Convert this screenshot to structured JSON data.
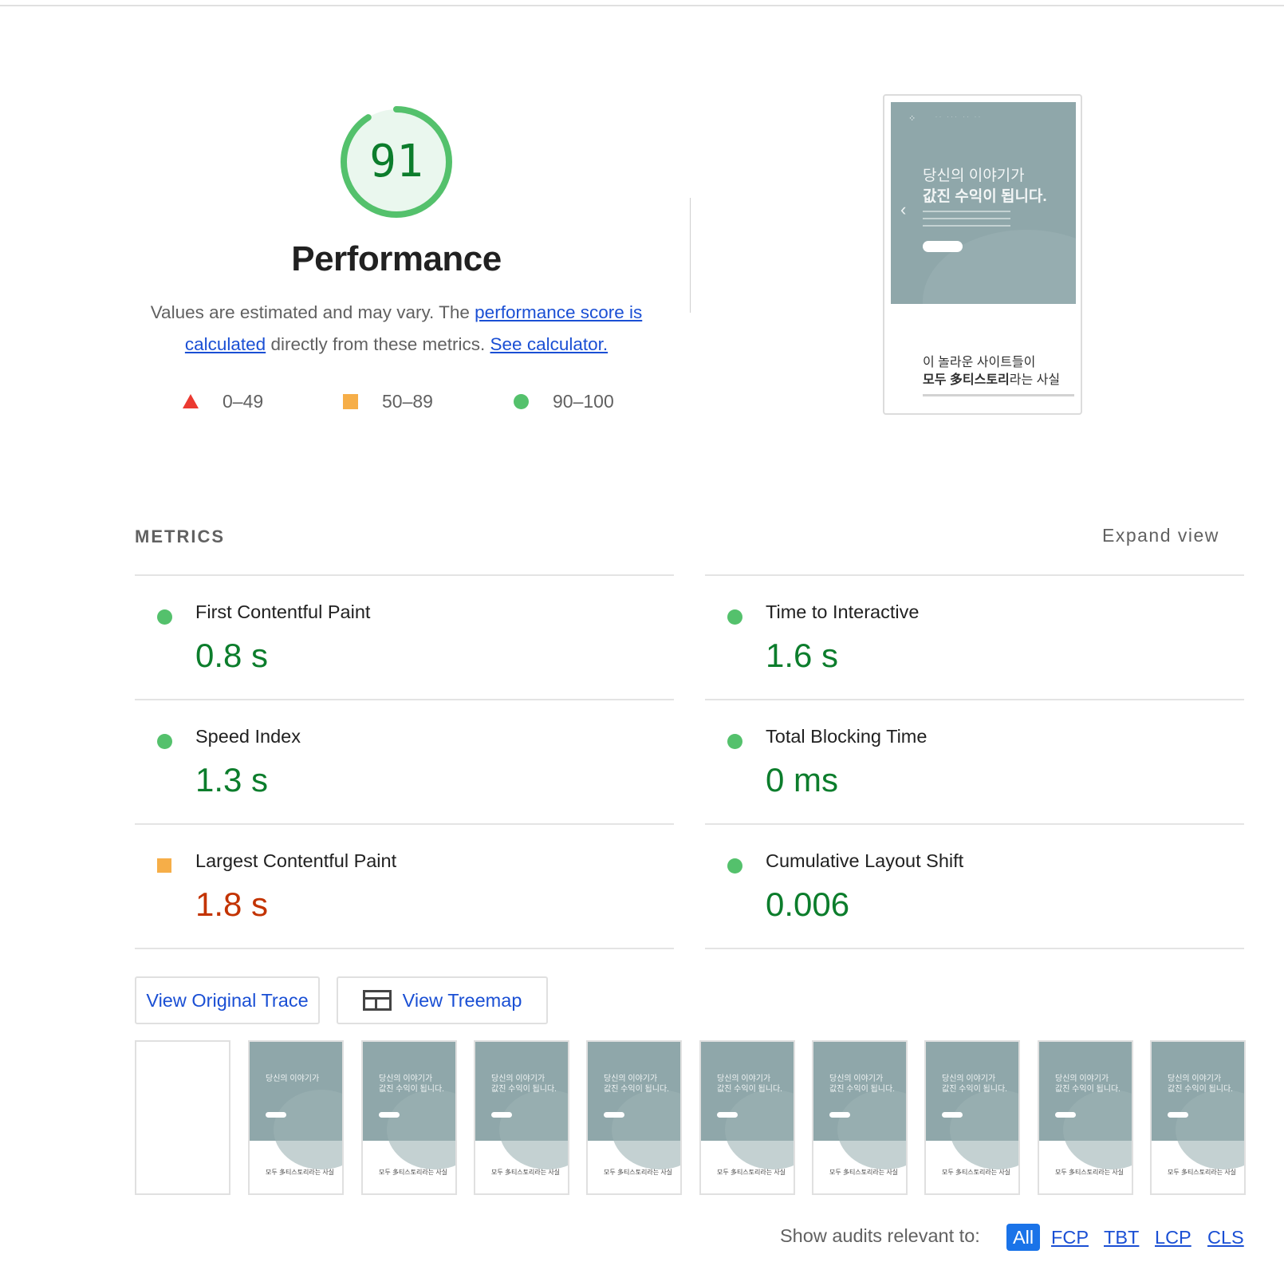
{
  "category": {
    "score": "91",
    "score_fraction": 0.91,
    "title": "Performance",
    "desc_text1": "Values are estimated and may vary. The ",
    "desc_link1": "performance score is calculated",
    "desc_text2": " directly from these metrics. ",
    "desc_link2": "See calculator."
  },
  "legend": [
    {
      "label": "0–49",
      "shape": "triangle",
      "color": "#eb3a31"
    },
    {
      "label": "50–89",
      "shape": "square",
      "color": "#f6ae48"
    },
    {
      "label": "90–100",
      "shape": "circle",
      "color": "#54c16c"
    }
  ],
  "preview": {
    "headline_line1": "당신의 이야기가",
    "headline_line2": "값진 수익이 됩니다.",
    "section_line1": "이 놀라운 사이트들이",
    "section_line2_bold": "모두 多티스토리",
    "section_line2_rest": "라는 사실"
  },
  "metrics": {
    "title": "METRICS",
    "expand_label": "Expand view",
    "items": [
      {
        "name": "First Contentful Paint",
        "value": "0.8 s",
        "rating": "good"
      },
      {
        "name": "Time to Interactive",
        "value": "1.6 s",
        "rating": "good"
      },
      {
        "name": "Speed Index",
        "value": "1.3 s",
        "rating": "good"
      },
      {
        "name": "Total Blocking Time",
        "value": "0 ms",
        "rating": "good"
      },
      {
        "name": "Largest Contentful Paint",
        "value": "1.8 s",
        "rating": "average"
      },
      {
        "name": "Cumulative Layout Shift",
        "value": "0.006",
        "rating": "good"
      }
    ]
  },
  "buttons": {
    "trace": "View Original Trace",
    "treemap": "View Treemap"
  },
  "filmstrip": {
    "frame_line1": "당신의 이야기가",
    "frame_line2": "값진 수익이 됩니다.",
    "frame_bottom": "모두 多티스토리라는 사실"
  },
  "audits": {
    "label": "Show audits relevant to:",
    "filters": [
      "All",
      "FCP",
      "TBT",
      "LCP",
      "CLS"
    ]
  },
  "colors": {
    "good": "#0c7d2c",
    "average": "#c33300",
    "link": "#1a4fd4",
    "accent": "#1a73e8"
  }
}
